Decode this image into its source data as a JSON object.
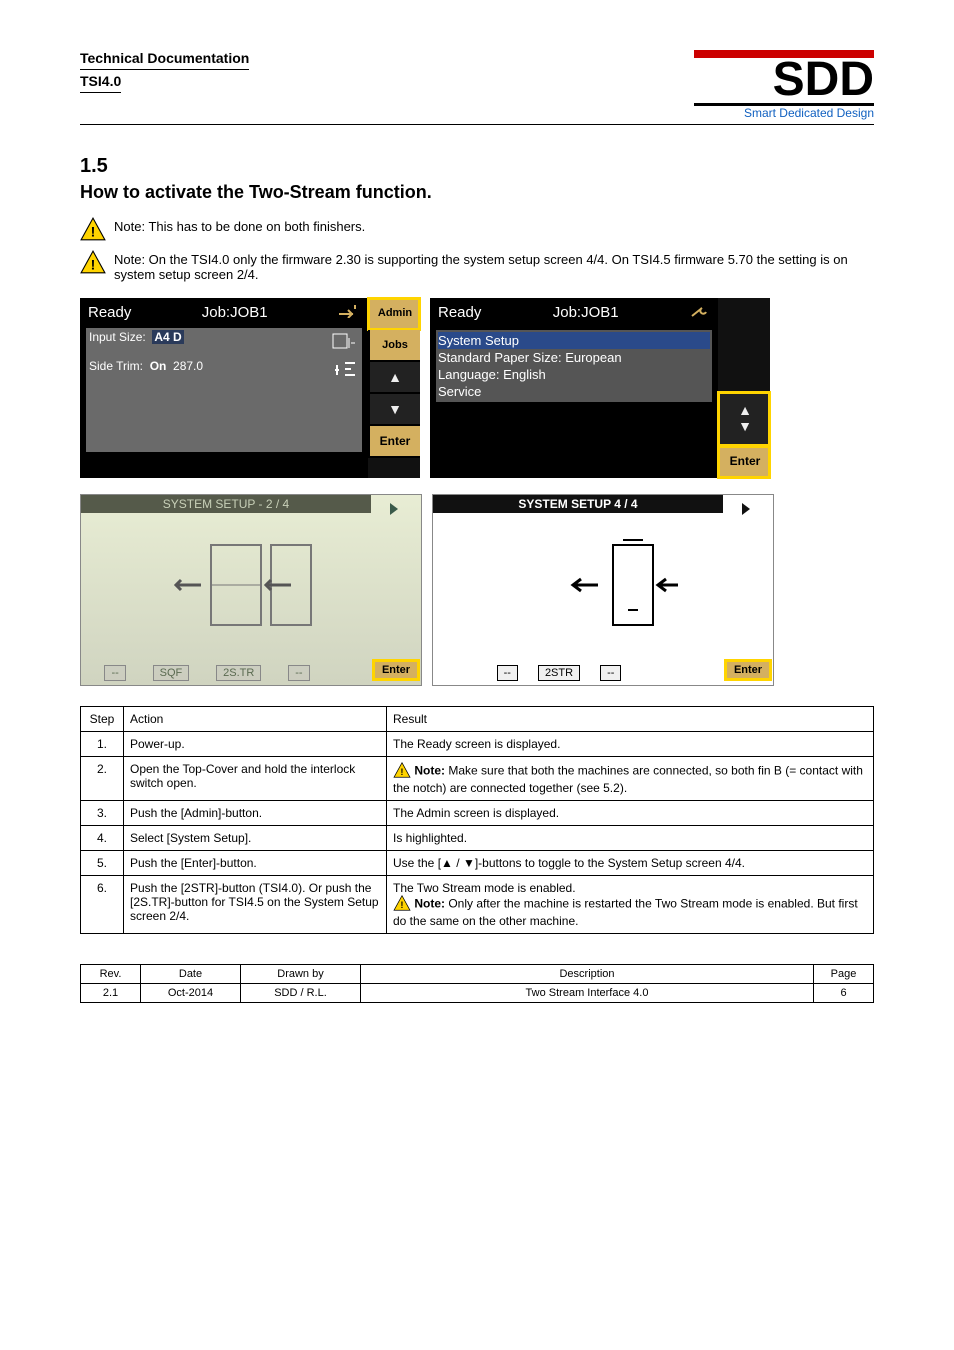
{
  "header": {
    "line1": "Technical Documentation",
    "line2": "TSI4.0",
    "logo_main": "SDD",
    "logo_sub": "Smart Dedicated Design"
  },
  "section": {
    "number": "1.5",
    "title": "How to activate the Two-Stream function."
  },
  "warnings": {
    "w1": "Note: This has to be done on both finishers.",
    "w2": "Note: On the TSI4.0 only the firmware 2.30 is supporting the system setup screen 4/4. On TSI4.5 firmware 5.70 the setting is on system setup screen 2/4."
  },
  "screen1": {
    "status": "Ready",
    "job": "Job:JOB1",
    "row1_label": "Input Size:",
    "row1_val1": "A4 D",
    "row2_label": "Side Trim:",
    "row2_val1": "On",
    "row2_val2": "287.0",
    "side": {
      "admin": "Admin",
      "jobs": "Jobs",
      "enter": "Enter"
    }
  },
  "screen2": {
    "status": "Ready",
    "job": "Job:JOB1",
    "row1": "System Setup",
    "row2": "Standard Paper Size: European",
    "row3": "Language: English",
    "row4": "Service",
    "enter": "Enter"
  },
  "screen3": {
    "title": "SYSTEM SETUP - 2 / 4",
    "labels": {
      "a": "--",
      "b": "SQF",
      "c": "2S.TR",
      "d": "--"
    },
    "enter": "Enter"
  },
  "screen4": {
    "title": "SYSTEM SETUP 4 / 4",
    "labels": {
      "a": "--",
      "b": "2STR",
      "c": "--"
    },
    "enter": "Enter"
  },
  "table_header": {
    "step": "Step",
    "action": "Action",
    "result": "Result"
  },
  "steps": {
    "s1": {
      "n": "1.",
      "action": "Power-up.",
      "result": "The Ready screen is displayed."
    },
    "s2": {
      "n": "2.",
      "action": "Open the Top-Cover and hold the interlock switch open.",
      "result_strong": "Note:",
      "result_rest": " Make sure that both the machines are connected, so both fin B (= contact with the notch) are connected together (see 5.2)."
    },
    "s3": {
      "n": "3.",
      "action": "Push the [Admin]-button.",
      "result": "The Admin screen is displayed."
    },
    "s4": {
      "n": "4.",
      "action": "Select [System Setup].",
      "result": "Is highlighted."
    },
    "s5": {
      "n": "5.",
      "action": "Push the [Enter]-button.",
      "result_pre": "Use the [",
      "result_mid": " / ",
      "result_post": "]-buttons to toggle to the System Setup screen 4/4."
    },
    "s6": {
      "n": "6.",
      "action": "Push the [2STR]-button (TSI4.0). Or push the [2S.TR]-button for TSI4.5 on the System Setup screen 2/4.",
      "result_l1": "The Two Stream mode is enabled.",
      "result_strong": "Note:",
      "result_rest": " Only after the machine is restarted the Two Stream mode is enabled. But first do the same on the other machine."
    }
  },
  "footer": {
    "headers": {
      "rev": "Rev.",
      "date": "Date",
      "drawn": "Drawn by",
      "desc": "Description",
      "page": "Page"
    },
    "values": {
      "rev": "2.1",
      "date": "Oct-2014",
      "drawn": "SDD / R.L.",
      "desc": "Two Stream Interface 4.0",
      "page": "6"
    }
  }
}
